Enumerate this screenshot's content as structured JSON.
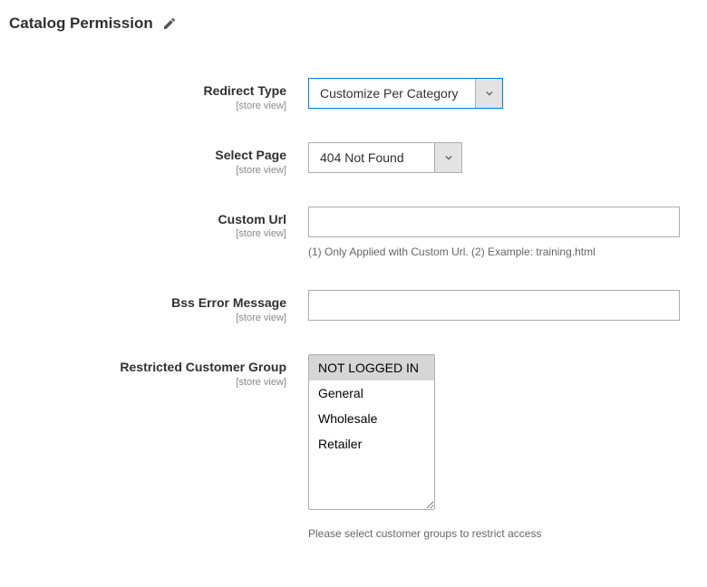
{
  "section": {
    "title": "Catalog Permission"
  },
  "scope_label": "[store view]",
  "fields": {
    "redirect_type": {
      "label": "Redirect Type",
      "value": "Customize Per Category",
      "options": [
        "Customize Per Category"
      ]
    },
    "select_page": {
      "label": "Select Page",
      "value": "404 Not Found",
      "options": [
        "404 Not Found"
      ]
    },
    "custom_url": {
      "label": "Custom Url",
      "value": "",
      "hint": "(1) Only Applied with Custom Url. (2) Example: training.html"
    },
    "error_message": {
      "label": "Bss Error Message",
      "value": ""
    },
    "restricted_group": {
      "label": "Restricted Customer Group",
      "options": [
        "NOT LOGGED IN",
        "General",
        "Wholesale",
        "Retailer"
      ],
      "selected": [
        "NOT LOGGED IN"
      ],
      "hint": "Please select customer groups to restrict access"
    }
  }
}
